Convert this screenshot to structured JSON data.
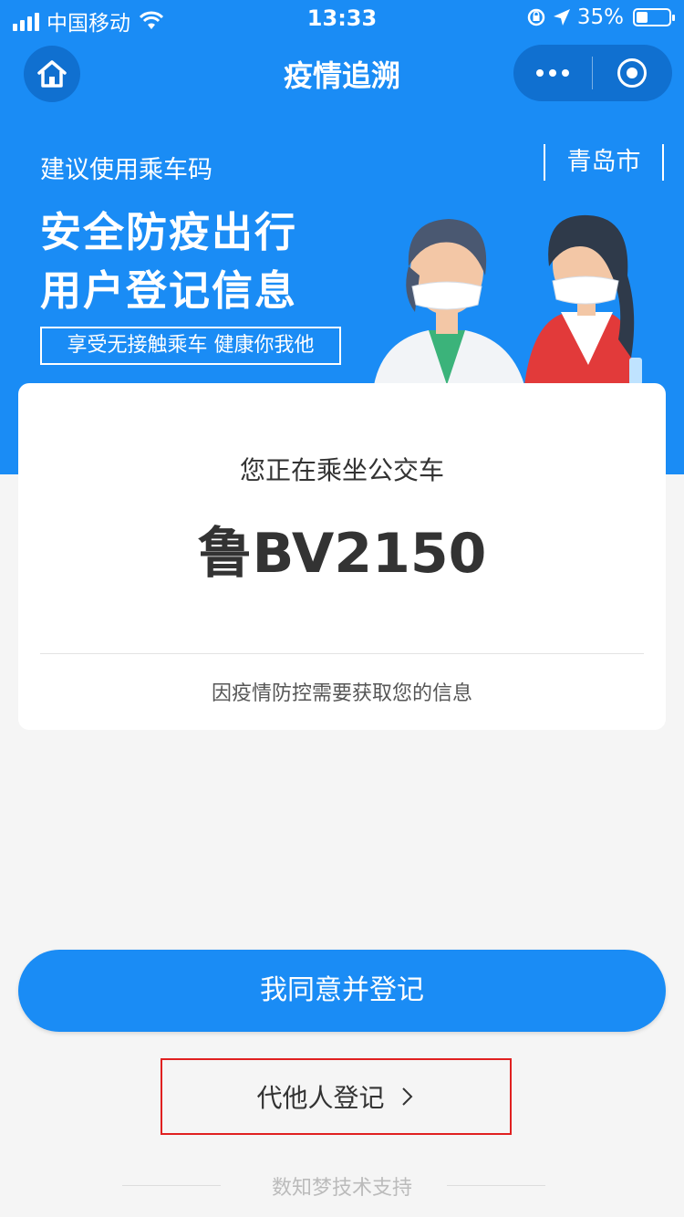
{
  "status_bar": {
    "carrier": "中国移动",
    "time": "13:33",
    "battery": "35%",
    "battery_level": 0.35,
    "icons": [
      "signal-icon",
      "wifi-icon",
      "rotation-lock-icon",
      "location-icon",
      "battery-icon"
    ]
  },
  "nav": {
    "title": "疫情追溯",
    "home_icon": "home-icon",
    "more_icon": "more-icon",
    "close_icon": "target-icon"
  },
  "hero": {
    "suggest": "建议使用乘车码",
    "city": "青岛市",
    "headline_1": "安全防疫出行",
    "headline_2": "用户登记信息",
    "tagline": "享受无接触乘车 健康你我他",
    "background_color": "#1a8cf5"
  },
  "card": {
    "riding_label": "您正在乘坐公交车",
    "plate": "鲁BV2150",
    "notice": "因疫情防控需要获取您的信息"
  },
  "actions": {
    "agree_label": "我同意并登记",
    "proxy_label": "代他人登记",
    "proxy_highlight_color": "#e02020"
  },
  "footer": {
    "text": "数知梦技术支持"
  }
}
